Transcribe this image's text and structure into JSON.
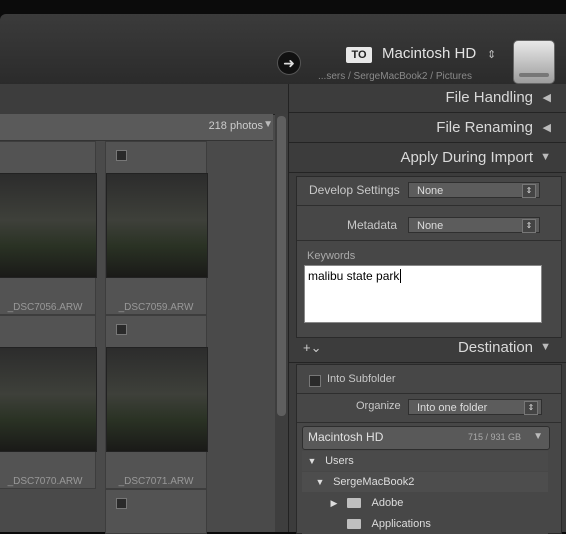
{
  "header": {
    "arrow_icon": "arrow-right-icon",
    "to_badge": "TO",
    "destination_name": "Macintosh HD",
    "destination_chevron": "⌃⌄",
    "destination_path": "...sers / SergeMacBook2 / Pictures",
    "drive_icon": "hard-drive-icon"
  },
  "grid": {
    "photo_count": "218 photos",
    "cells": [
      {
        "filename": "_DSC7056.ARW"
      },
      {
        "filename": "_DSC7059.ARW"
      },
      {
        "filename": "_DSC7070.ARW"
      },
      {
        "filename": "_DSC7071.ARW"
      }
    ]
  },
  "right": {
    "sections": {
      "file_handling": "File Handling",
      "file_renaming": "File Renaming",
      "apply_during_import": "Apply During Import",
      "destination": "Destination"
    },
    "develop_settings_label": "Develop Settings",
    "develop_settings_value": "None",
    "metadata_label": "Metadata",
    "metadata_value": "None",
    "keywords_label": "Keywords",
    "keywords_value": "malibu state park",
    "into_subfolder_label": "Into Subfolder",
    "organize_label": "Organize",
    "organize_value": "Into one folder",
    "volume_name": "Macintosh HD",
    "volume_size": "715 / 931 GB",
    "tree": [
      "Users",
      "SergeMacBook2",
      "Adobe",
      "Applications"
    ]
  }
}
